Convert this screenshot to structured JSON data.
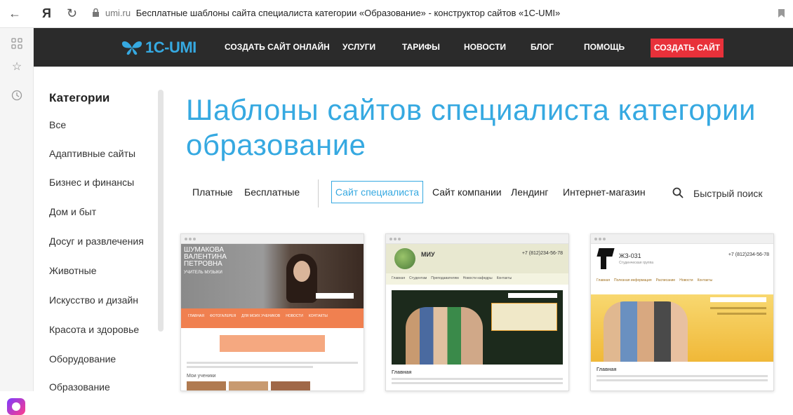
{
  "browser": {
    "domain": "umi.ru",
    "title": "Бесплатные шаблоны сайта специалиста категории «Образование» - конструктор сайтов «1С-UMI»"
  },
  "header": {
    "logo_text": "1C-UMI",
    "nav": [
      "СОЗДАТЬ САЙТ ОНЛАЙН",
      "УСЛУГИ",
      "ТАРИФЫ",
      "НОВОСТИ",
      "БЛОГ",
      "ПОМОЩЬ"
    ],
    "cta": "СОЗДАТЬ САЙТ"
  },
  "sidebar": {
    "title": "Категории",
    "items": [
      "Все",
      "Адаптивные сайты",
      "Бизнес и финансы",
      "Дом и быт",
      "Досуг и развлечения",
      "Животные",
      "Искусство и дизайн",
      "Красота и здоровье",
      "Оборудование",
      "Образование"
    ]
  },
  "main": {
    "title": "Шаблоны сайтов специалиста категории образование",
    "price_filters": [
      "Платные",
      "Бесплатные"
    ],
    "type_tabs": [
      "Сайт специалиста",
      "Сайт компании",
      "Лендинг",
      "Интернет-магазин"
    ],
    "active_tab": "Сайт специалиста",
    "search_label": "Быстрый поиск"
  },
  "templates": [
    {
      "name": "ШУМАКОВА ВАЛЕНТИНА ПЕТРОВНА",
      "subtitle": "УЧИТЕЛЬ МУЗЫКИ",
      "menu": [
        "ГЛАВНАЯ",
        "ФОТОГАЛЕРЕЯ",
        "ДЛЯ МОИХ УЧЕНИКОВ",
        "НОВОСТИ",
        "КОНТАКТЫ"
      ],
      "section": "Мои ученики",
      "accent": "#f08050"
    },
    {
      "name": "МИУ",
      "phone": "+7 (812)234-56-78",
      "menu": [
        "Главная",
        "Студентам",
        "Преподавателям",
        "Новости кафедры",
        "Контакты"
      ],
      "section": "Главная",
      "accent": "#e8a030"
    },
    {
      "name": "ЖЗ-031",
      "subtitle": "Студенческая группа",
      "phone": "+7 (812)234-56-78",
      "menu": [
        "Главная",
        "Полезная информация",
        "Расписание",
        "Новости",
        "Контакты"
      ],
      "section": "Главная",
      "accent": "#f5c84a"
    }
  ]
}
